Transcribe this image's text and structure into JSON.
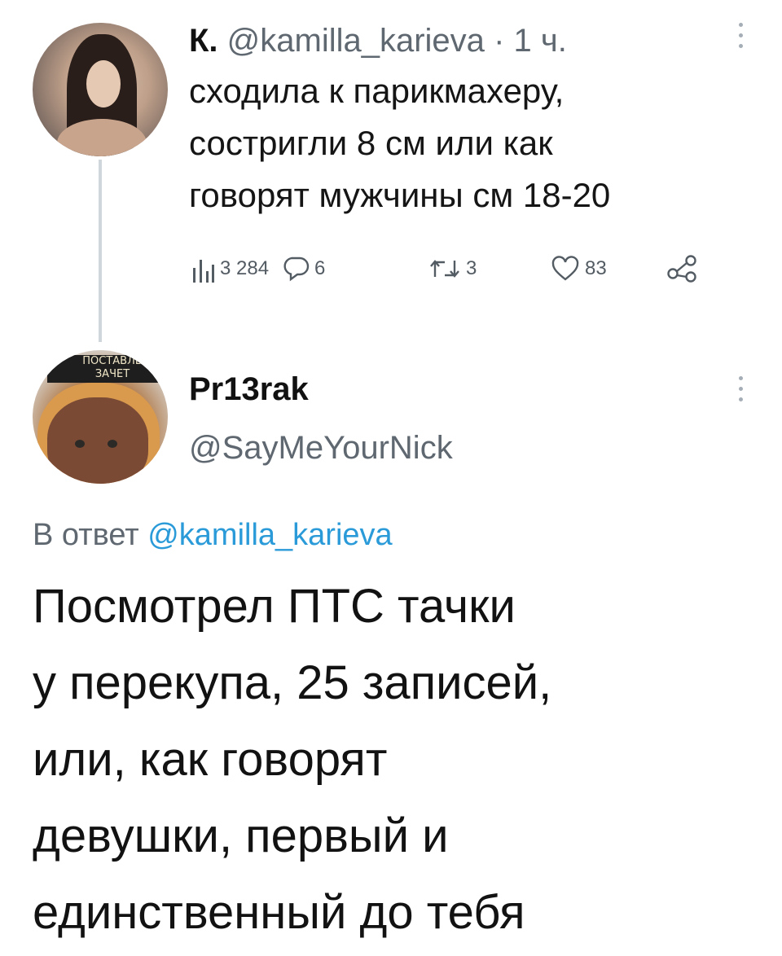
{
  "tweet1": {
    "author_name": "К.",
    "handle": "@kamilla_karieva",
    "separator": "·",
    "time": "1 ч.",
    "text_lines": [
      "сходила к парикмахеру,",
      "состригли 8 см или как",
      "говорят мужчины см 18-20"
    ],
    "stats": {
      "views": "3 284",
      "replies": "6",
      "retweets": "3",
      "likes": "83"
    },
    "icons": {
      "views": "views-bar-chart-icon",
      "reply": "reply-bubble-icon",
      "retweet": "retweet-icon",
      "like": "heart-icon",
      "share": "share-icon",
      "more": "more-dots-icon"
    }
  },
  "tweet2": {
    "author_name": "Pr13rak",
    "handle": "@SayMeYourNick",
    "avatar_caption_lines": [
      "ПОСТАВЛЬ",
      "ЗАЧЕТ"
    ],
    "reply_prefix": "В ответ",
    "reply_mention": "@kamilla_karieva",
    "text_lines": [
      "Посмотрел ПТС тачки",
      "у перекупа, 25 записей,",
      "или, как говорят",
      "девушки, первый и",
      "единственный до тебя"
    ]
  },
  "colors": {
    "text": "#121212",
    "secondary_text": "#5f6870",
    "mention": "#2a9bd8",
    "thread_line": "#cfd6dc"
  }
}
